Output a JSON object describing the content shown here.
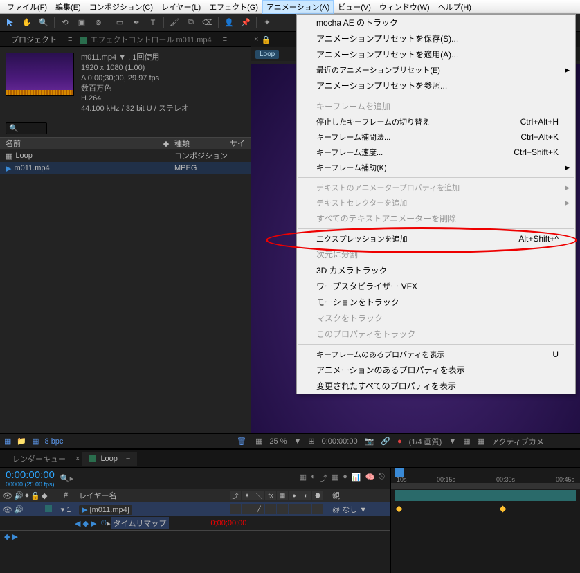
{
  "menubar": {
    "file": "ファイル(F)",
    "edit": "編集(E)",
    "composition": "コンポジション(C)",
    "layer": "レイヤー(L)",
    "effect": "エフェクト(G)",
    "animation": "アニメーション(A)",
    "view": "ビュー(V)",
    "window": "ウィンドウ(W)",
    "help": "ヘルプ(H)"
  },
  "project_panel": {
    "tab_project": "プロジェクト",
    "tab_effect": "エフェクトコントロール m011.mp4",
    "item_name": "m011.mp4 ▼",
    "item_used": "1回使用",
    "resolution": "1920 x 1080 (1.00)",
    "duration": "Δ 0;00;30;00, 29.97 fps",
    "colors": "数百万色",
    "codec": "H.264",
    "audio": "44.100 kHz / 32 bit U / ステレオ",
    "col_name": "名前",
    "col_type": "種類",
    "col_size": "サイ",
    "row_loop": "Loop",
    "row_loop_type": "コンポジション",
    "row_m011": "m011.mp4",
    "row_m011_type": "MPEG",
    "bpc": "8 bpc"
  },
  "comp_panel": {
    "breadcrumb": "Loop",
    "zoom": "25 %",
    "timecode": "0:00:00:00",
    "quality": "(1/4 画質)",
    "active_camera": "アクティブカメ"
  },
  "animation_menu": {
    "mocha": "mocha AE のトラック",
    "save_preset": "アニメーションプリセットを保存(S)...",
    "apply_preset": "アニメーションプリセットを適用(A)...",
    "recent_presets": "最近のアニメーションプリセット(E)",
    "browse_presets": "アニメーションプリセットを参照...",
    "add_keyframe": "キーフレームを追加",
    "toggle_hold": "停止したキーフレームの切り替え",
    "toggle_hold_sc": "Ctrl+Alt+H",
    "interp": "キーフレーム補間法...",
    "interp_sc": "Ctrl+Alt+K",
    "velocity": "キーフレーム速度...",
    "velocity_sc": "Ctrl+Shift+K",
    "assist": "キーフレーム補助(K)",
    "text_animator": "テキストのアニメータープロパティを追加",
    "text_selector": "テキストセレクターを追加",
    "remove_text": "すべてのテキストアニメーターを削除",
    "add_expression": "エクスプレッションを追加",
    "add_expression_sc": "Alt+Shift+^",
    "split_dim": "次元に分割",
    "cam_track": "3D カメラトラック",
    "warp": "ワープスタビライザー VFX",
    "motion_track": "モーションをトラック",
    "mask_track": "マスクをトラック",
    "prop_track": "このプロパティをトラック",
    "reveal_kf": "キーフレームのあるプロパティを表示",
    "reveal_kf_sc": "U",
    "reveal_anim": "アニメーションのあるプロパティを表示",
    "reveal_mod": "変更されたすべてのプロパティを表示"
  },
  "timeline": {
    "tab_render": "レンダーキュー",
    "tab_loop": "Loop",
    "timecode": "0:00:00:00",
    "framerate": "00000 (25.00 fps)",
    "col_num": "#",
    "col_layer": "レイヤー名",
    "col_parent": "親",
    "tick_10": "10s",
    "tick_15": "00:15s",
    "tick_30": "00:30s",
    "tick_45": "00:45s",
    "layer1_num": "1",
    "layer1_name": "[m011.mp4]",
    "layer1_parent": "なし",
    "layer1_prop": "タイムリマップ",
    "layer1_prop_tc": "0;00;00;00"
  }
}
